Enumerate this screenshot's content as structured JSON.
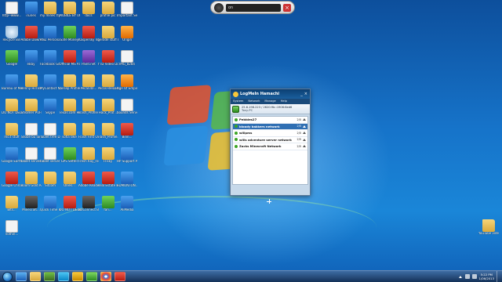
{
  "media_bar": {
    "screen_text": "on"
  },
  "hamachi": {
    "title": "LogMeIn Hamachi",
    "menu": [
      "System",
      "Network",
      "Manage",
      "Help"
    ],
    "ip": "25.6.198.223 / 2620:9b::1906:6ed6",
    "client_name": "Tony-PC",
    "networks": [
      {
        "name": "Pebbles27",
        "count": "2/5",
        "selected": false
      },
      {
        "name": "bloody bakkers network",
        "count": "2/5",
        "selected": true
      },
      {
        "name": "willpms",
        "count": "2/5",
        "selected": false
      },
      {
        "name": "wills adventure server network",
        "count": "2/5",
        "selected": false
      },
      {
        "name": "Zacks Minecraft Network",
        "count": "2/5",
        "selected": false
      }
    ]
  },
  "desktop_icons": [
    {
      "label": "http--www...",
      "type": "doc"
    },
    {
      "label": "iTunes",
      "type": "app-blue"
    },
    {
      "label": "my minec fly NOT DELETE",
      "type": "folder"
    },
    {
      "label": "MOBILE BY 0666",
      "type": "folder"
    },
    {
      "label": "docs",
      "type": "folder"
    },
    {
      "label": "profile pic",
      "type": "folder"
    },
    {
      "label": "Important Server S...",
      "type": "doc"
    },
    {
      "label": "Recycle Bin",
      "type": "recycle"
    },
    {
      "label": "Adobe Downloa...",
      "type": "app-red"
    },
    {
      "label": "ANZ Persona...",
      "type": "app-blue"
    },
    {
      "label": "Safe Money",
      "type": "app-green"
    },
    {
      "label": "Kaspersky Internet Se...",
      "type": "app-red"
    },
    {
      "label": "gerode stuff Don't delete",
      "type": "folder"
    },
    {
      "label": "Origin",
      "type": "app-orange"
    },
    {
      "label": "Google",
      "type": "app-green"
    },
    {
      "label": "eBay",
      "type": "app-blue"
    },
    {
      "label": "Facebook Gift",
      "type": "app-blue"
    },
    {
      "label": "Official MS Ar Rh...",
      "type": "app-red"
    },
    {
      "label": "Paint.net",
      "type": "app-purple"
    },
    {
      "label": "YTD Video Downloader",
      "type": "app-red"
    },
    {
      "label": "IMG_8284",
      "type": "doc"
    },
    {
      "label": "Bureau of Meteorolo...",
      "type": "app-blue"
    },
    {
      "label": "Benny Hill Brewery-PE...",
      "type": "folder"
    },
    {
      "label": "MyContact Net Jessa...",
      "type": "app-blue"
    },
    {
      "label": "Jailsep Profile...",
      "type": "folder"
    },
    {
      "label": "Pecan40...",
      "type": "folder"
    },
    {
      "label": "Pecos-Reloaded",
      "type": "folder"
    },
    {
      "label": "Age Of Empires 2 ...",
      "type": "app-orange"
    },
    {
      "label": "DO NOT DELETE",
      "type": "folder"
    },
    {
      "label": "Steamer PUFFDE D...",
      "type": "folder"
    },
    {
      "label": "Skype",
      "type": "app-blue"
    },
    {
      "label": "Texas.com Hack entb...",
      "type": "folder"
    },
    {
      "label": "Flash_Profile Drone_...",
      "type": "folder"
    },
    {
      "label": "Hack_Prof...",
      "type": "folder"
    },
    {
      "label": "bounds Server.exe",
      "type": "doc"
    },
    {
      "label": "mo.t stuff",
      "type": "folder"
    },
    {
      "label": "adobe bu lan update",
      "type": "doc"
    },
    {
      "label": "Tablet tree Data-Video...",
      "type": "doc"
    },
    {
      "label": "sofia swe",
      "type": "folder"
    },
    {
      "label": "Flash First CO ...",
      "type": "folder"
    },
    {
      "label": "Flash_Profile...",
      "type": "folder"
    },
    {
      "label": "Binn...",
      "type": "app-red"
    },
    {
      "label": "Google Earth",
      "type": "app-blue"
    },
    {
      "label": "tablet server MacDonald ...",
      "type": "doc"
    },
    {
      "label": "tablet server GDrive...",
      "type": "doc"
    },
    {
      "label": "GPS Setter",
      "type": "app-green"
    },
    {
      "label": "Fresh Ray_Install...",
      "type": "folder"
    },
    {
      "label": "Frisky",
      "type": "folder"
    },
    {
      "label": "HP Support Assistant",
      "type": "app-blue"
    },
    {
      "label": "Google Chrome",
      "type": "app-red"
    },
    {
      "label": "Boom Gold Adobe Reader...",
      "type": "folder"
    },
    {
      "label": "Sitcom",
      "type": "folder"
    },
    {
      "label": "Ollies...",
      "type": "folder"
    },
    {
      "label": "Adobe Reader X",
      "type": "app-red"
    },
    {
      "label": "Real Estate Properties...",
      "type": "app-red"
    },
    {
      "label": "EDMONTON...",
      "type": "app-blue"
    },
    {
      "label": "Bits...",
      "type": "folder"
    },
    {
      "label": "Minecraft...",
      "type": "app-dark"
    },
    {
      "label": "Quick Time Player",
      "type": "app-blue"
    },
    {
      "label": "DO NOT DELETE 2 L...",
      "type": "app-red"
    },
    {
      "label": "NoConnect Bot",
      "type": "app-dark"
    },
    {
      "label": "fan...",
      "type": "app-green"
    },
    {
      "label": "AliMedia",
      "type": "app-blue"
    },
    {
      "label": "nothin...",
      "type": "doc"
    }
  ],
  "right_icon": {
    "label": "YouTube videos",
    "type": "folder"
  },
  "taskbar": {
    "pinned": [
      "ie",
      "explorer",
      "minecraft",
      "skype",
      "hamachi",
      "utorrent",
      "chrome",
      "ytd"
    ],
    "clock_time": "5:22 PM",
    "clock_date": "1/06/2013"
  }
}
